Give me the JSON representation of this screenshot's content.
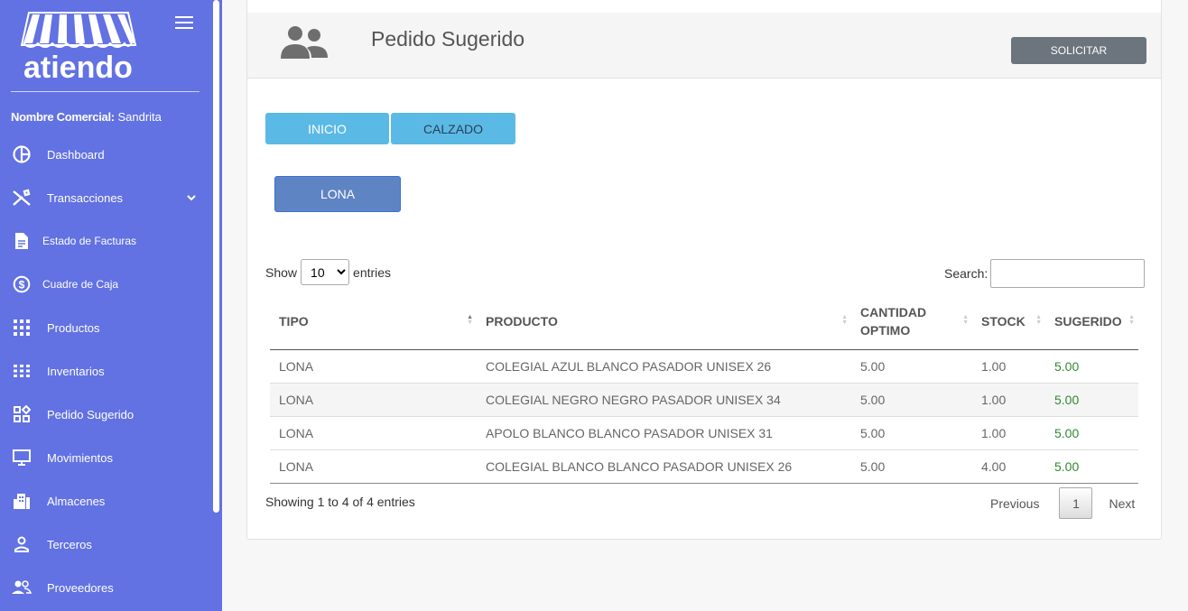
{
  "brand": {
    "logo_text": "atiendo"
  },
  "sidebar": {
    "comercial_label": "Nombre Comercial:",
    "comercial_value": "Sandrita",
    "items": [
      {
        "label": "Dashboard",
        "icon": "pie-chart-icon"
      },
      {
        "label": "Transacciones",
        "icon": "tools-icon"
      },
      {
        "label": "Estado de Facturas",
        "icon": "document-icon"
      },
      {
        "label": "Cuadre de Caja",
        "icon": "dollar-circle-icon"
      },
      {
        "label": "Productos",
        "icon": "grid-icon"
      },
      {
        "label": "Inventarios",
        "icon": "grid-icon"
      },
      {
        "label": "Pedido Sugerido",
        "icon": "widgets-icon"
      },
      {
        "label": "Movimientos",
        "icon": "monitor-icon"
      },
      {
        "label": "Almacenes",
        "icon": "building-icon"
      },
      {
        "label": "Terceros",
        "icon": "person-icon"
      },
      {
        "label": "Proveedores",
        "icon": "people-icon"
      }
    ]
  },
  "header": {
    "title": "Pedido Sugerido",
    "solicitar": "SOLICITAR"
  },
  "categories": {
    "inicio": "INICIO",
    "calzado": "CALZADO",
    "lona": "LONA"
  },
  "table_controls": {
    "show": "Show",
    "entries_value": "10",
    "entries": "entries",
    "search": "Search:"
  },
  "table": {
    "columns": [
      "TIPO",
      "PRODUCTO",
      "CANTIDAD OPTIMO",
      "STOCK",
      "SUGERIDO"
    ],
    "rows": [
      [
        "LONA",
        "COLEGIAL AZUL BLANCO PASADOR UNISEX 26",
        "5.00",
        "1.00",
        "5.00"
      ],
      [
        "LONA",
        "COLEGIAL NEGRO NEGRO PASADOR UNISEX 34",
        "5.00",
        "1.00",
        "5.00"
      ],
      [
        "LONA",
        "APOLO BLANCO BLANCO PASADOR UNISEX 31",
        "5.00",
        "1.00",
        "5.00"
      ],
      [
        "LONA",
        "COLEGIAL BLANCO BLANCO PASADOR UNISEX 26",
        "5.00",
        "4.00",
        "5.00"
      ]
    ]
  },
  "footer": {
    "showing": "Showing 1 to 4 of 4 entries",
    "previous": "Previous",
    "page": "1",
    "next": "Next"
  },
  "colors": {
    "sidebar": "#6272e3",
    "accent_button": "#5bbae5",
    "lona_button": "#5f84c4",
    "sugerido_value": "#2f8a2f"
  }
}
